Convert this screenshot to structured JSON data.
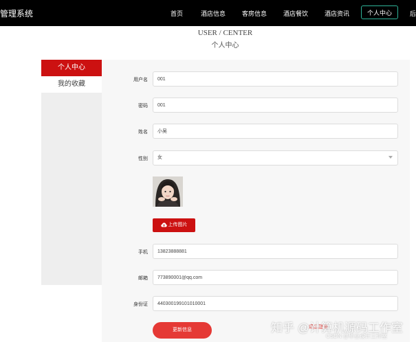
{
  "nav": {
    "brand": "管理系统",
    "items": [
      "首页",
      "酒店信息",
      "客房信息",
      "酒店餐饮",
      "酒店资讯"
    ],
    "active": "个人中心",
    "cut": "后"
  },
  "heading": {
    "en": "USER / CENTER",
    "cn": "个人中心"
  },
  "sidebar": {
    "active": "个人中心",
    "favorites": "我的收藏"
  },
  "form": {
    "username": {
      "label": "用户名",
      "value": "001"
    },
    "password": {
      "label": "密码",
      "value": "001"
    },
    "name": {
      "label": "姓名",
      "value": "小吴"
    },
    "gender": {
      "label": "性别",
      "value": "女"
    },
    "upload_button": "上传图片",
    "phone": {
      "label": "手机",
      "value": "13823888881"
    },
    "email": {
      "label": "邮箱",
      "value": "773890001@qq.com"
    },
    "id_card": {
      "label": "身份证",
      "value": "440300199101010001"
    },
    "update_button": "更新信息",
    "logout": "退出登录"
  },
  "watermark": {
    "main": "知乎 @计算机源码工作室",
    "sub": "CSDN @毕业设计工作室"
  },
  "colors": {
    "accent": "#cc1111",
    "nav_active_border": "#2fb59a",
    "update_button": "#e53935"
  }
}
